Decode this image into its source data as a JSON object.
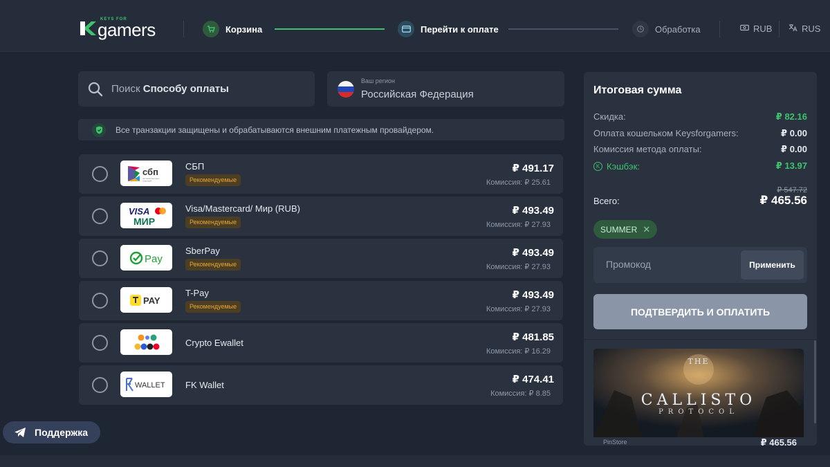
{
  "header": {
    "logo_small": "KEYS FOR",
    "logo_word": "gamers",
    "steps": [
      {
        "label": "Корзина",
        "icon": "cart-icon"
      },
      {
        "label": "Перейти к оплате",
        "icon": "credit-card-icon"
      },
      {
        "label": "Обработка",
        "icon": "processing-icon"
      }
    ],
    "currency": "RUB",
    "language": "RUS"
  },
  "search": {
    "prefix": "Поиск",
    "bold": "Способу оплаты"
  },
  "region": {
    "label": "Ваш регион",
    "value": "Российская Федерация"
  },
  "secure_notice": "Все транзакции защищены и обрабатываются внешним платежным провайдером.",
  "methods": [
    {
      "name": "СБП",
      "badge": "Рекомендуемые",
      "price": "₽ 491.17",
      "fee": "Комиссия: ₽ 25.61",
      "logo": "sbp-logo",
      "logo_text": "сбп"
    },
    {
      "name": "Visa/Mastercard/ Мир (RUB)",
      "badge": "Рекомендуемые",
      "price": "₽ 493.49",
      "fee": "Комиссия: ₽ 27.93",
      "logo": "visa-mir-logo",
      "logo_text": "VISA"
    },
    {
      "name": "SberPay",
      "badge": "Рекомендуемые",
      "price": "₽ 493.49",
      "fee": "Комиссия: ₽ 27.93",
      "logo": "sberpay-logo",
      "logo_text": "Pay"
    },
    {
      "name": "T-Pay",
      "badge": "Рекомендуемые",
      "price": "₽ 493.49",
      "fee": "Комиссия: ₽ 27.93",
      "logo": "tpay-logo",
      "logo_text": "PAY"
    },
    {
      "name": "Crypto Ewallet",
      "badge": "",
      "price": "₽ 481.85",
      "fee": "Комиссия: ₽ 16.29",
      "logo": "crypto-logo",
      "logo_text": ""
    },
    {
      "name": "FK Wallet",
      "badge": "",
      "price": "₽ 474.41",
      "fee": "Комиссия: ₽ 8.85",
      "logo": "fkwallet-logo",
      "logo_text": "WALLET"
    }
  ],
  "summary": {
    "title": "Итоговая сумма",
    "rows": [
      {
        "label": "Скидка:",
        "value": "₽ 82.16"
      },
      {
        "label": "Оплата кошельком Keysforgamers:",
        "value": "₽ 0.00"
      },
      {
        "label": "Комиссия метода оплаты:",
        "value": "₽ 0.00"
      },
      {
        "label": "Кэшбэк:",
        "value": "₽ 13.97"
      }
    ],
    "total_label": "Всего:",
    "old_total": "₽ 547.72",
    "total": "₽ 465.56",
    "promo_chip": "SUMMER",
    "promo_placeholder": "Промокод",
    "apply_label": "Применить",
    "pay_label": "ПОДТВЕРДИТЬ И ОПЛАТИТЬ"
  },
  "game": {
    "title_line1": "THE",
    "title_line2": "CALLISTO",
    "title_line3": "PROTOCOL",
    "store": "PinStore",
    "price": "₽ 465.56"
  },
  "support_label": "Поддержка",
  "colors": {
    "accent_green": "#3ec26b",
    "background": "#1f2633",
    "panel": "#2a3240",
    "badge_text": "#e5a63a"
  }
}
